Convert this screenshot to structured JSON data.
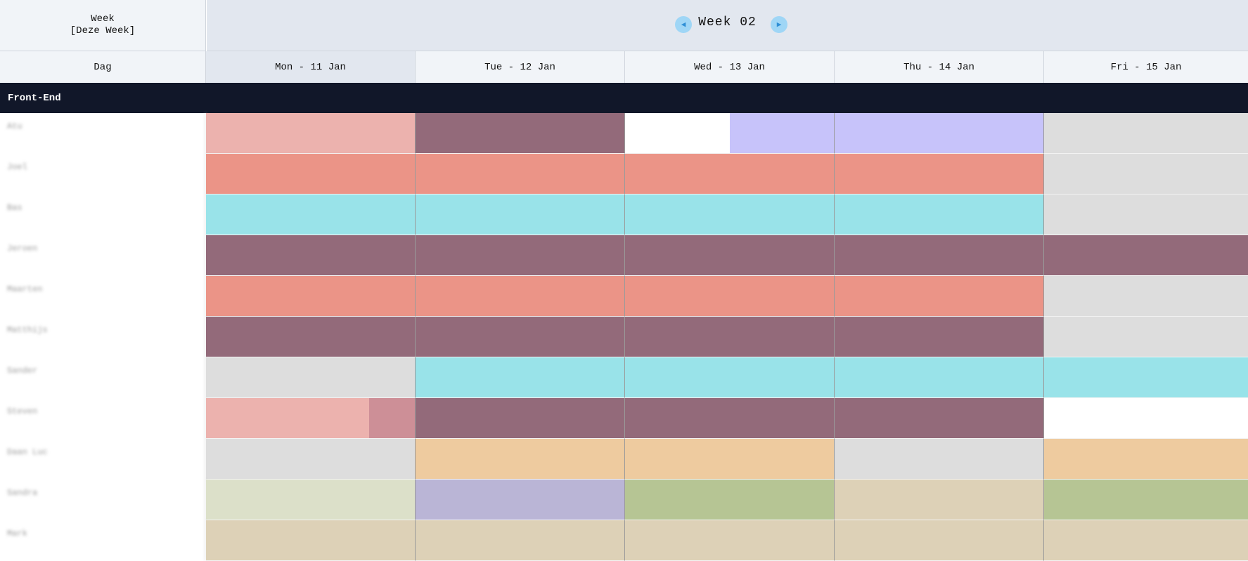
{
  "header": {
    "week_label_line1": "Week",
    "week_label_line2": "[Deze Week]",
    "week_title": "Week 02",
    "prev_icon": "◀",
    "next_icon": "▶"
  },
  "columns": {
    "dag_label": "Dag",
    "days": [
      "Mon - 11 Jan",
      "Tue - 12 Jan",
      "Wed - 13 Jan",
      "Thu - 14 Jan",
      "Fri - 15 Jan"
    ]
  },
  "group": {
    "name": "Front-End"
  },
  "colors": {
    "pink": "#ecb2ae",
    "salmon": "#eb9487",
    "cyan": "#99e3e9",
    "plum": "#936a7a",
    "grey": "#dddddd",
    "lavender": "#c7c3fa",
    "rose": "#cd8f97",
    "orange": "#eecb9f",
    "sage": "#dce0c9",
    "purple": "#bab5d6",
    "green": "#b6c594",
    "tan": "#ddd1b7",
    "white": "#ffffff"
  },
  "rows": [
    {
      "name": "Atu",
      "cells": [
        [
          [
            "pink",
            1
          ]
        ],
        [
          [
            "plum",
            1
          ]
        ],
        [
          [
            "white",
            0.5
          ],
          [
            "lavender",
            0.5
          ]
        ],
        [
          [
            "lavender",
            1
          ]
        ],
        [
          [
            "grey",
            1
          ]
        ]
      ]
    },
    {
      "name": "Joel",
      "cells": [
        [
          [
            "salmon",
            1
          ]
        ],
        [
          [
            "salmon",
            1
          ]
        ],
        [
          [
            "salmon",
            1
          ]
        ],
        [
          [
            "salmon",
            1
          ]
        ],
        [
          [
            "grey",
            1
          ]
        ]
      ]
    },
    {
      "name": "Bas",
      "cells": [
        [
          [
            "cyan",
            1
          ]
        ],
        [
          [
            "cyan",
            1
          ]
        ],
        [
          [
            "cyan",
            1
          ]
        ],
        [
          [
            "cyan",
            1
          ]
        ],
        [
          [
            "grey",
            1
          ]
        ]
      ]
    },
    {
      "name": "Jeroen",
      "cells": [
        [
          [
            "plum",
            1
          ]
        ],
        [
          [
            "plum",
            1
          ]
        ],
        [
          [
            "plum",
            1
          ]
        ],
        [
          [
            "plum",
            1
          ]
        ],
        [
          [
            "plum",
            1
          ]
        ]
      ]
    },
    {
      "name": "Maarten",
      "cells": [
        [
          [
            "salmon",
            1
          ]
        ],
        [
          [
            "salmon",
            1
          ]
        ],
        [
          [
            "salmon",
            1
          ]
        ],
        [
          [
            "salmon",
            1
          ]
        ],
        [
          [
            "grey",
            1
          ]
        ]
      ]
    },
    {
      "name": "Matthijs",
      "cells": [
        [
          [
            "plum",
            1
          ]
        ],
        [
          [
            "plum",
            1
          ]
        ],
        [
          [
            "plum",
            1
          ]
        ],
        [
          [
            "plum",
            1
          ]
        ],
        [
          [
            "grey",
            1
          ]
        ]
      ]
    },
    {
      "name": "Sander",
      "cells": [
        [
          [
            "grey",
            1
          ]
        ],
        [
          [
            "cyan",
            1
          ]
        ],
        [
          [
            "cyan",
            1
          ]
        ],
        [
          [
            "cyan",
            1
          ]
        ],
        [
          [
            "cyan",
            1
          ]
        ]
      ]
    },
    {
      "name": "Steven",
      "cells": [
        [
          [
            "pink",
            0.78
          ],
          [
            "rose",
            0.22
          ]
        ],
        [
          [
            "plum",
            1
          ]
        ],
        [
          [
            "plum",
            1
          ]
        ],
        [
          [
            "plum",
            1
          ]
        ],
        [
          [
            "white",
            1
          ]
        ]
      ]
    },
    {
      "name": "Daan Luc",
      "cells": [
        [
          [
            "grey",
            1
          ]
        ],
        [
          [
            "orange",
            1
          ]
        ],
        [
          [
            "orange",
            1
          ]
        ],
        [
          [
            "grey",
            1
          ]
        ],
        [
          [
            "orange",
            1
          ]
        ]
      ]
    },
    {
      "name": "Sandra",
      "cells": [
        [
          [
            "sage",
            1
          ]
        ],
        [
          [
            "purple",
            1
          ]
        ],
        [
          [
            "green",
            1
          ]
        ],
        [
          [
            "tan",
            1
          ]
        ],
        [
          [
            "green",
            1
          ]
        ]
      ]
    },
    {
      "name": "Mark",
      "cells": [
        [
          [
            "tan",
            1
          ]
        ],
        [
          [
            "tan",
            1
          ]
        ],
        [
          [
            "tan",
            1
          ]
        ],
        [
          [
            "tan",
            1
          ]
        ],
        [
          [
            "tan",
            1
          ]
        ]
      ]
    }
  ]
}
